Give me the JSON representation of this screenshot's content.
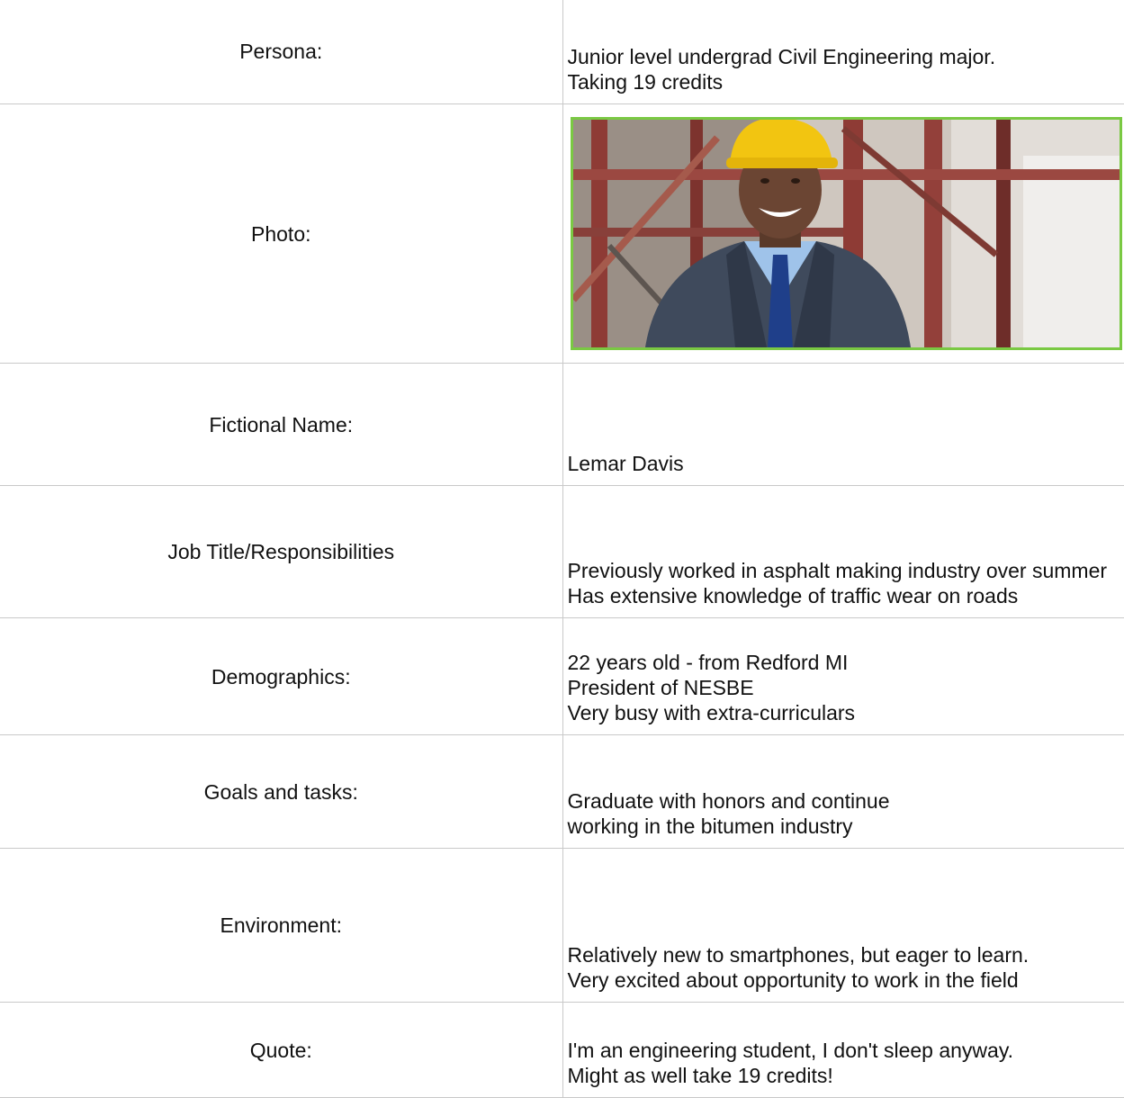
{
  "rows": [
    {
      "label": "Persona:",
      "lines": [
        "Junior level undergrad Civil Engineering major.",
        "Taking 19 credits"
      ]
    },
    {
      "label": "Photo:",
      "image": "smiling-engineer-in-yellow-hard-hat-and-suit-photo"
    },
    {
      "label": "Fictional Name:",
      "lines": [
        "Lemar Davis"
      ]
    },
    {
      "label": "Job Title/Responsibilities",
      "lines": [
        "Previously worked in asphalt making industry over summer",
        "Has extensive knowledge of traffic wear on roads"
      ]
    },
    {
      "label": "Demographics:",
      "lines": [
        "22 years old - from Redford MI",
        "President of NESBE",
        "Very busy with extra-curriculars"
      ]
    },
    {
      "label": "Goals and tasks:",
      "lines": [
        "Graduate with honors and continue",
        "working in the bitumen industry"
      ]
    },
    {
      "label": "Environment:",
      "lines": [
        "Relatively new to smartphones, but eager to learn.",
        "Very excited about opportunity to work in the field"
      ]
    },
    {
      "label": "Quote:",
      "lines": [
        "I'm an engineering student, I don't sleep anyway.",
        "Might as well take 19 credits!"
      ]
    }
  ],
  "colors": {
    "grid": "#c9c9c9",
    "photo_border": "#7ac943",
    "hard_hat": "#f2c511",
    "suit": "#3f4a5c",
    "tie": "#1f3f8a"
  }
}
